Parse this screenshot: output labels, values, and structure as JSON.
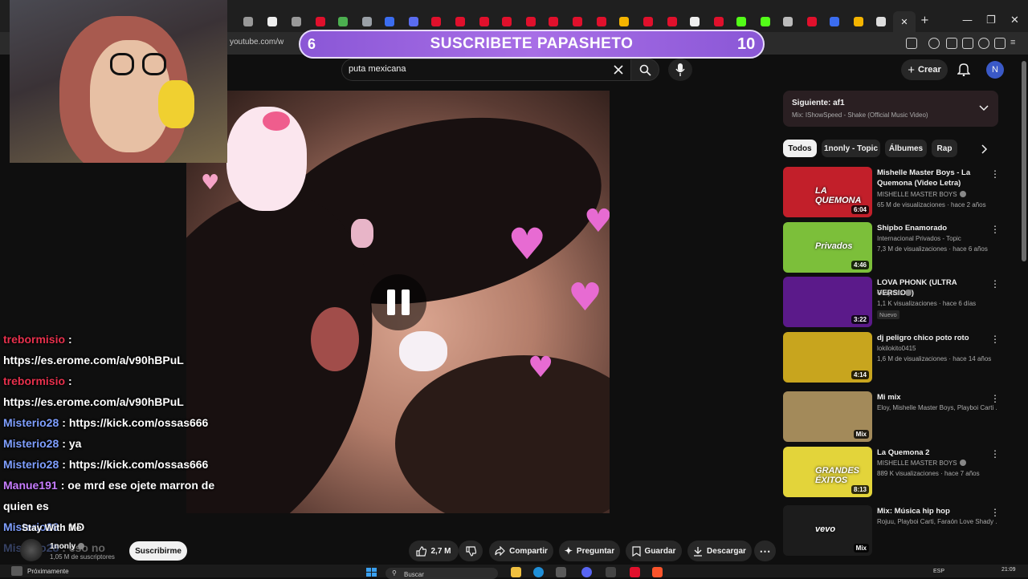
{
  "browser": {
    "url": "youtube.com/w",
    "window_controls": {
      "minimize": "—",
      "maximize": "❐",
      "close": "✕"
    },
    "new_tab": "+",
    "tab_close": "✕"
  },
  "stream_banner": {
    "left_counter": "6",
    "title": "SUSCRIBETE PAPASHETO",
    "right_counter": "10"
  },
  "youtube": {
    "search_query": "puta mexicana",
    "create_label": "Crear",
    "avatar_letter": "N"
  },
  "video": {
    "now_playing": "Stay With Me",
    "channel_name": "1nonly",
    "subscribers": "1,05 M de suscriptores",
    "subscribe_label": "Suscribirme",
    "actions": {
      "likes": "2,7 M",
      "share": "Compartir",
      "ask": "Preguntar",
      "save": "Guardar",
      "download": "Descargar"
    }
  },
  "chat": [
    {
      "user": "trebormisio",
      "color": "#e8314d",
      "message": "https://es.erome.com/a/v90hBPuL"
    },
    {
      "user": "trebormisio",
      "color": "#e8314d",
      "message": "https://es.erome.com/a/v90hBPuL"
    },
    {
      "user": "Misterio28",
      "color": "#7f9fff",
      "message": "https://kick.com/ossas666"
    },
    {
      "user": "Misterio28",
      "color": "#7f9fff",
      "message": "ya"
    },
    {
      "user": "Misterio28",
      "color": "#7f9fff",
      "message": "https://kick.com/ossas666"
    },
    {
      "user": "Manue191",
      "color": "#c77dff",
      "message": "oe mrd ese ojete marron de quien es"
    },
    {
      "user": "Misterio28",
      "color": "#7f9fff",
      "message": "XD"
    },
    {
      "user": "Misterio28",
      "color": "#7f9fff",
      "message": "eso no"
    }
  ],
  "sidebar": {
    "up_next_label": "Siguiente: af1",
    "up_next_sub": "Mix: IShowSpeed - Shake (Official Music Video)",
    "chips": [
      "Todos",
      "1nonly - Topic",
      "Álbumes",
      "Rap"
    ],
    "videos": [
      {
        "title": "Mishelle Master Boys - La Quemona (Video Letra)",
        "channel": "MISHELLE MASTER BOYS",
        "verified": true,
        "meta": "65 M de visualizaciones · hace 2 años",
        "duration": "6:04",
        "thumb": "#c21f2a",
        "thumb_text": "LA QUEMONA"
      },
      {
        "title": "Shipbo Enamorado",
        "channel": "Internacional Privados - Topic",
        "verified": false,
        "meta": "7,3 M de visualizaciones · hace 6 años",
        "duration": "4:46",
        "thumb": "#7cbf3a",
        "thumb_text": "Privados"
      },
      {
        "title": "LOVA PHONK (ULTRA VERSION)",
        "channel": "Oraymos",
        "verified": true,
        "meta": "1,1 K visualizaciones · hace 6 días",
        "duration": "3:22",
        "thumb": "#5b1a8a",
        "thumb_text": "",
        "badge": "Nuevo"
      },
      {
        "title": "dj peligro chico poto roto",
        "channel": "lokilokito0415",
        "verified": false,
        "meta": "1,6 M de visualizaciones · hace 14 años",
        "duration": "4:14",
        "thumb": "#c8a51e",
        "thumb_text": ""
      },
      {
        "title": "Mi mix",
        "channel": "Eloy, Mishelle Master Boys, Playboi Carti ...",
        "verified": false,
        "meta": "",
        "duration": "Mix",
        "thumb": "#a38a5a",
        "thumb_text": ""
      },
      {
        "title": "La Quemona 2",
        "channel": "MISHELLE MASTER BOYS",
        "verified": true,
        "meta": "889 K visualizaciones · hace 7 años",
        "duration": "8:13",
        "thumb": "#e3d43a",
        "thumb_text": "GRANDES ÉXITOS"
      },
      {
        "title": "Mix: Música hip hop",
        "channel": "Rojuu, Playboi Carti, Faraón Love Shady ...",
        "verified": false,
        "meta": "",
        "duration": "Mix",
        "thumb": "#1c1c1c",
        "thumb_text": "vevo"
      }
    ]
  },
  "taskbar": {
    "status": "Próximamente",
    "search": "Buscar",
    "lang": "ESP",
    "time": "21:09"
  },
  "colors": {
    "accent": "#a86ee6",
    "background": "#0f0f0f"
  }
}
